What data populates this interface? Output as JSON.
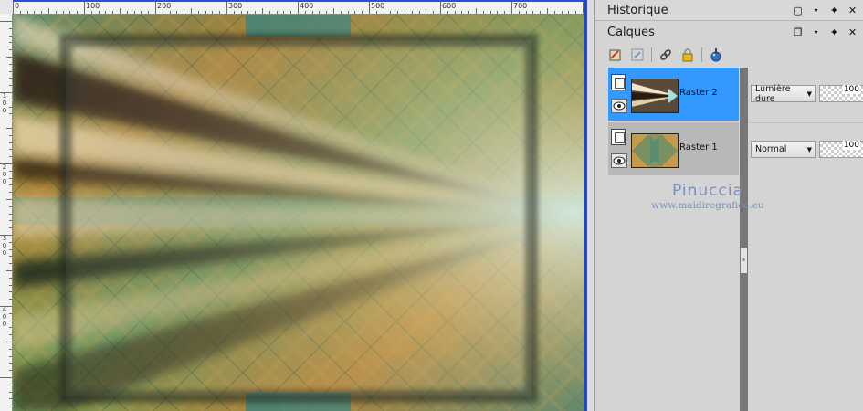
{
  "palettes": {
    "history": {
      "title": "Historique"
    },
    "layers": {
      "title": "Calques"
    }
  },
  "ruler": {
    "h_labels": [
      "0",
      "100",
      "200",
      "300",
      "400",
      "500",
      "600",
      "700"
    ],
    "v_labels": [
      "1\n0\n0",
      "2\n0\n0",
      "3\n0\n0",
      "4\n0\n0"
    ]
  },
  "layers": [
    {
      "name": "Raster 2",
      "blend_mode": "Lumière dure",
      "opacity": "100",
      "selected": true
    },
    {
      "name": "Raster 1",
      "blend_mode": "Normal",
      "opacity": "100",
      "selected": false
    }
  ],
  "toolbar_icons": [
    "new-layer-icon",
    "mask-icon",
    "link-icon",
    "lock-icon",
    "paint-tool-icon"
  ],
  "watermark": {
    "name": "Pinuccia",
    "url": "www.maidiregrafica.eu"
  },
  "colors": {
    "selected_layer": "#3399ff",
    "accent_blue": "#2c4fd3"
  }
}
